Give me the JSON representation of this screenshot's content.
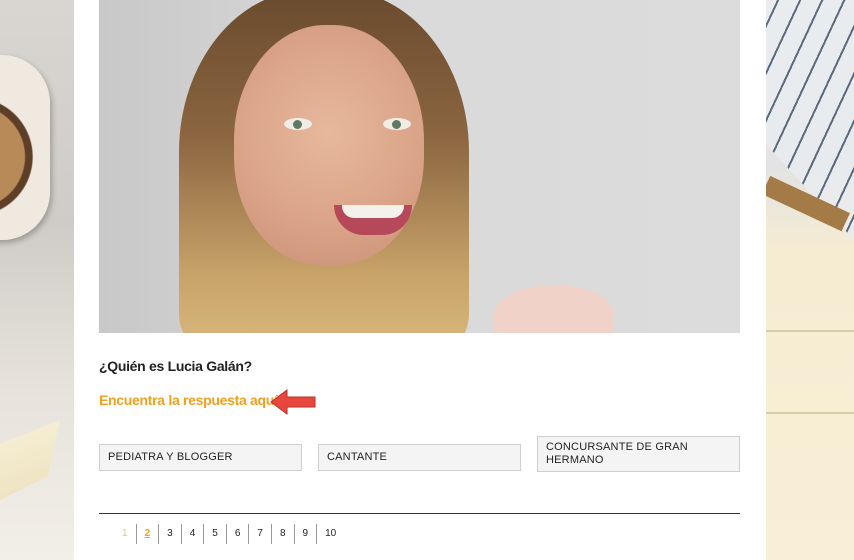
{
  "quiz": {
    "question": "¿Quién es Lucia Galán?",
    "answer_link": "Encuentra la respuesta aquí.",
    "options": [
      "PEDIATRA Y BLOGGER",
      "CANTANTE",
      "CONCURSANTE DE GRAN HERMANO"
    ]
  },
  "pagination": {
    "pages": [
      "1",
      "2",
      "3",
      "4",
      "5",
      "6",
      "7",
      "8",
      "9",
      "10"
    ],
    "current": "2"
  },
  "colors": {
    "accent": "#f0a01c",
    "arrow": "#e8473e"
  }
}
